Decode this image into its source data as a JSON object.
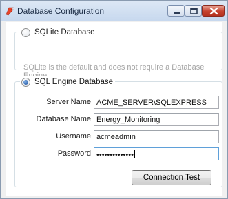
{
  "window": {
    "title": "Database Configuration",
    "icon": "app-icon",
    "controls": [
      "minimize-icon",
      "maximize-icon",
      "close-icon"
    ]
  },
  "sqlite": {
    "label": "SQLite Database",
    "selected": false,
    "description": "SQLite is the default and does not require a Database Engine."
  },
  "sqlengine": {
    "label": "SQL Engine Database",
    "selected": true,
    "fields": {
      "server_name": {
        "label": "Server Name",
        "value": "ACME_SERVER\\SQLEXPRESS"
      },
      "database_name": {
        "label": "Database Name",
        "value": "Energy_Monitoring"
      },
      "username": {
        "label": "Username",
        "value": "acmeadmin"
      },
      "password": {
        "label": "Password",
        "value": "••••••••••••••"
      }
    },
    "test_button": "Connection Test"
  }
}
